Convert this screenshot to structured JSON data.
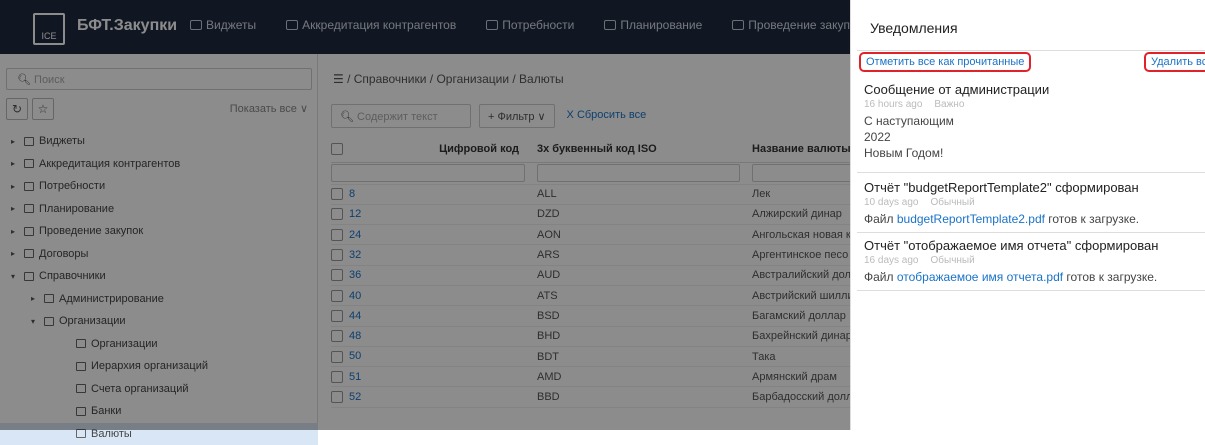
{
  "app": {
    "logo_text": "ICE",
    "brand": "БФТ.Закупки"
  },
  "nav": [
    {
      "label": "Виджеты",
      "icon": "widget-icon"
    },
    {
      "label": "Аккредитация контрагентов",
      "icon": "accreditation-icon"
    },
    {
      "label": "Потребности",
      "icon": "needs-icon"
    },
    {
      "label": "Планирование",
      "icon": "calendar-icon"
    },
    {
      "label": "Проведение закупок",
      "icon": "cart-icon"
    }
  ],
  "sidebar": {
    "search_placeholder": "Поиск",
    "show_all": "Показать все ∨",
    "items": [
      {
        "label": "Виджеты",
        "arrow": "▸",
        "level": 0
      },
      {
        "label": "Аккредитация контрагентов",
        "arrow": "▸",
        "level": 0
      },
      {
        "label": "Потребности",
        "arrow": "▸",
        "level": 0
      },
      {
        "label": "Планирование",
        "arrow": "▸",
        "level": 0
      },
      {
        "label": "Проведение закупок",
        "arrow": "▸",
        "level": 0
      },
      {
        "label": "Договоры",
        "arrow": "▸",
        "level": 0
      },
      {
        "label": "Справочники",
        "arrow": "▾",
        "level": 0
      },
      {
        "label": "Администрирование",
        "arrow": "▸",
        "level": 1
      },
      {
        "label": "Организации",
        "arrow": "▾",
        "level": 1
      },
      {
        "label": "Организации",
        "arrow": "",
        "level": 2
      },
      {
        "label": "Иерархия организаций",
        "arrow": "",
        "level": 2
      },
      {
        "label": "Счета организаций",
        "arrow": "",
        "level": 2
      },
      {
        "label": "Банки",
        "arrow": "",
        "level": 2
      },
      {
        "label": "Валюты",
        "arrow": "",
        "level": 2
      }
    ]
  },
  "main": {
    "breadcrumb": "☰ / Справочники / Организации / Валюты",
    "filter_placeholder": "Содержит текст",
    "filter_button": "+ Фильтр ∨",
    "reset": "X Сбросить все",
    "columns": [
      "Цифровой код",
      "3х буквенный код ISO",
      "Название валюты"
    ],
    "rows": [
      {
        "code": "8",
        "iso": "ALL",
        "name": "Лек"
      },
      {
        "code": "12",
        "iso": "DZD",
        "name": "Алжирский динар"
      },
      {
        "code": "24",
        "iso": "AON",
        "name": "Ангольская новая кв"
      },
      {
        "code": "32",
        "iso": "ARS",
        "name": "Аргентинское песо"
      },
      {
        "code": "36",
        "iso": "AUD",
        "name": "Австралийский долл"
      },
      {
        "code": "40",
        "iso": "ATS",
        "name": "Австрийский шилли"
      },
      {
        "code": "44",
        "iso": "BSD",
        "name": "Багамский доллар"
      },
      {
        "code": "48",
        "iso": "BHD",
        "name": "Бахрейнский динар"
      },
      {
        "code": "50",
        "iso": "BDT",
        "name": "Така"
      },
      {
        "code": "51",
        "iso": "AMD",
        "name": "Армянский драм"
      },
      {
        "code": "52",
        "iso": "BBD",
        "name": "Барбадосский долл"
      }
    ]
  },
  "notifications": {
    "title": "Уведомления",
    "mark_all_read": "Отметить все как прочитанные",
    "delete_all": "Удалить все",
    "items": [
      {
        "title": "Сообщение от администрации",
        "time": "16 hours ago",
        "priority": "Важно",
        "lines": [
          "С наступающим",
          "2022",
          "Новым Годом!"
        ]
      },
      {
        "title": "Отчёт \"budgetReportTemplate2\" сформирован",
        "time": "10 days ago",
        "priority": "Обычный",
        "prefix": "Файл ",
        "link": "budgetReportTemplate2.pdf",
        "suffix": " готов к загрузке."
      },
      {
        "title": "Отчёт \"отображаемое имя отчета\" сформирован",
        "time": "16 days ago",
        "priority": "Обычный",
        "prefix": "Файл ",
        "link": "отображаемое имя отчета.pdf",
        "suffix": " готов к загрузке."
      }
    ]
  },
  "colors": {
    "topbar": "#1f2a3e",
    "link": "#1a73c8",
    "highlight_border": "#e0222b"
  }
}
